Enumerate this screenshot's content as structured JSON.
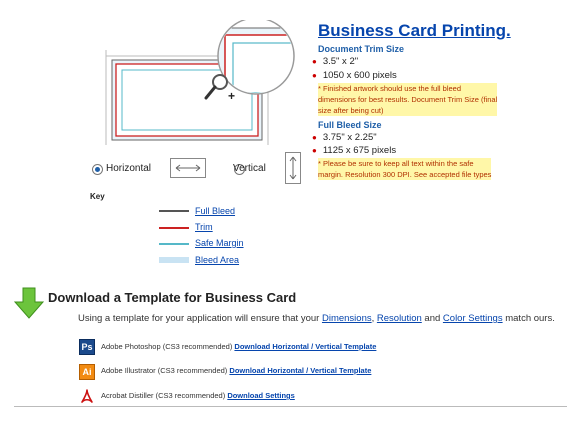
{
  "header": {
    "title": "Business Card Printing."
  },
  "trim": {
    "heading": "Document Trim Size",
    "sizes": [
      "3.5\" x 2\"",
      "1050 x 600 pixels"
    ],
    "note_lines": [
      "* Finished artwork should use the full bleed",
      "dimensions for best results. Document Trim Size (final",
      "size after being cut)"
    ]
  },
  "bleed": {
    "heading": "Full Bleed Size",
    "sizes": [
      "3.75\" x 2.25\"",
      "1125 x 675 pixels"
    ],
    "note_lines": [
      "* Please be sure to keep all text within the safe",
      "margin. Resolution 300 DPI. See accepted file types"
    ]
  },
  "orientation": {
    "horizontal_label": "Horizontal",
    "vertical_label": "Vertical",
    "selected": "Horizontal"
  },
  "key": {
    "label": "Key",
    "items": [
      {
        "label": "Full Bleed",
        "color": "#555555"
      },
      {
        "label": "Trim",
        "color": "#cc2222"
      },
      {
        "label": "Safe Margin",
        "color": "#55b8c8"
      },
      {
        "label": "Bleed Area",
        "color": "#c9e3f3"
      }
    ]
  },
  "download": {
    "title": "Download a Template for Business Card",
    "desc_prefix": "Using a template for your application will ensure that your ",
    "link_dimensions": "Dimensions",
    "sep1": ", ",
    "link_resolution": "Resolution",
    "sep2": " and ",
    "link_color": "Color Settings",
    "desc_suffix": " match ours.",
    "software": [
      {
        "icon": "Ps",
        "icon_color": "#1b4a8c",
        "name": "Adobe Photoshop (CS3 recommended)",
        "link": "Download Horizontal / Vertical Template"
      },
      {
        "icon": "Ai",
        "icon_color": "#f28b12",
        "name": "Adobe Illustrator (CS3 recommended)",
        "link": "Download Horizontal / Vertical Template"
      },
      {
        "icon": "pdf",
        "icon_color": "#cc1111",
        "name": "Acrobat Distiller (CS3 recommended)",
        "link": "Download Settings"
      }
    ]
  },
  "colors": {
    "link": "#0645ad",
    "accent_green": "#5fb832",
    "note_bg": "#fff7a8"
  }
}
